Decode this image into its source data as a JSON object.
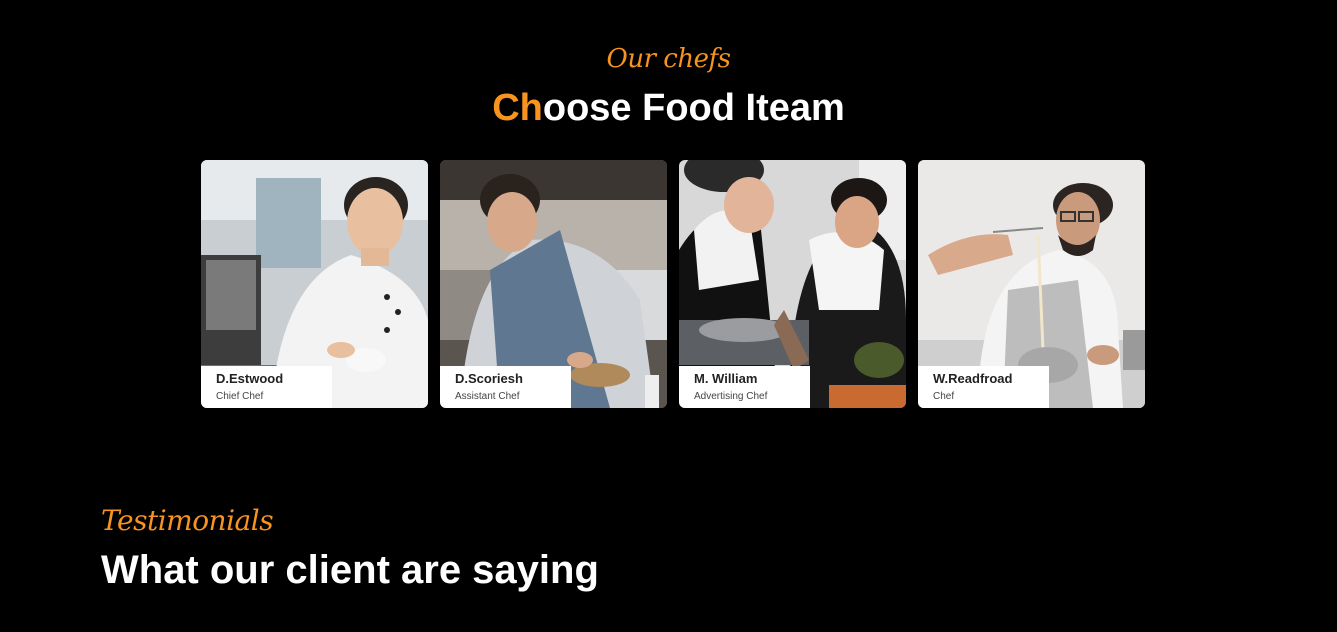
{
  "chefs_section": {
    "kicker": "Our chefs",
    "title_accent": "Ch",
    "title_rest": "oose Food Iteam",
    "accent_color": "#f7931e",
    "cards": [
      {
        "name": "D.Estwood",
        "role": "Chief Chef"
      },
      {
        "name": "D.Scoriesh",
        "role": "Assistant Chef"
      },
      {
        "name": "M. William",
        "role": "Advertising Chef"
      },
      {
        "name": "W.Readfroad",
        "role": "Chef"
      }
    ]
  },
  "testimonials_section": {
    "kicker": "Testimonials",
    "title": "What our client are saying"
  }
}
